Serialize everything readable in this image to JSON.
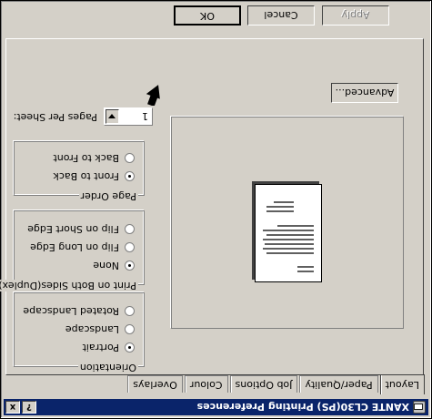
{
  "window": {
    "title": "XANTE CL30(PS) Printing Preferences",
    "help_label": "?",
    "close_label": "x"
  },
  "tabs": [
    "Layout",
    "Paper/Quality",
    "Job Options",
    "Colour",
    "Overlays"
  ],
  "orientation": {
    "legend": "Orientation",
    "options": [
      "Portrait",
      "Landscape",
      "Rotated Landscape"
    ],
    "selected": "Portrait"
  },
  "duplex": {
    "legend": "Print on Both Sides(Duplex)",
    "options": [
      "None",
      "Flip on Long Edge",
      "Flip on Short Edge"
    ],
    "selected": "None"
  },
  "page_order": {
    "legend": "Page Order",
    "options": [
      "Front to Back",
      "Back to Front"
    ],
    "selected": "Front to Back"
  },
  "pages_per_sheet": {
    "label": "Pages Per Sheet:",
    "value": "1"
  },
  "buttons": {
    "advanced": "Advanced...",
    "ok": "OK",
    "cancel": "Cancel",
    "apply": "Apply"
  },
  "icons": {
    "app": "printer-icon",
    "pointer": "arrow-pointer-icon"
  }
}
